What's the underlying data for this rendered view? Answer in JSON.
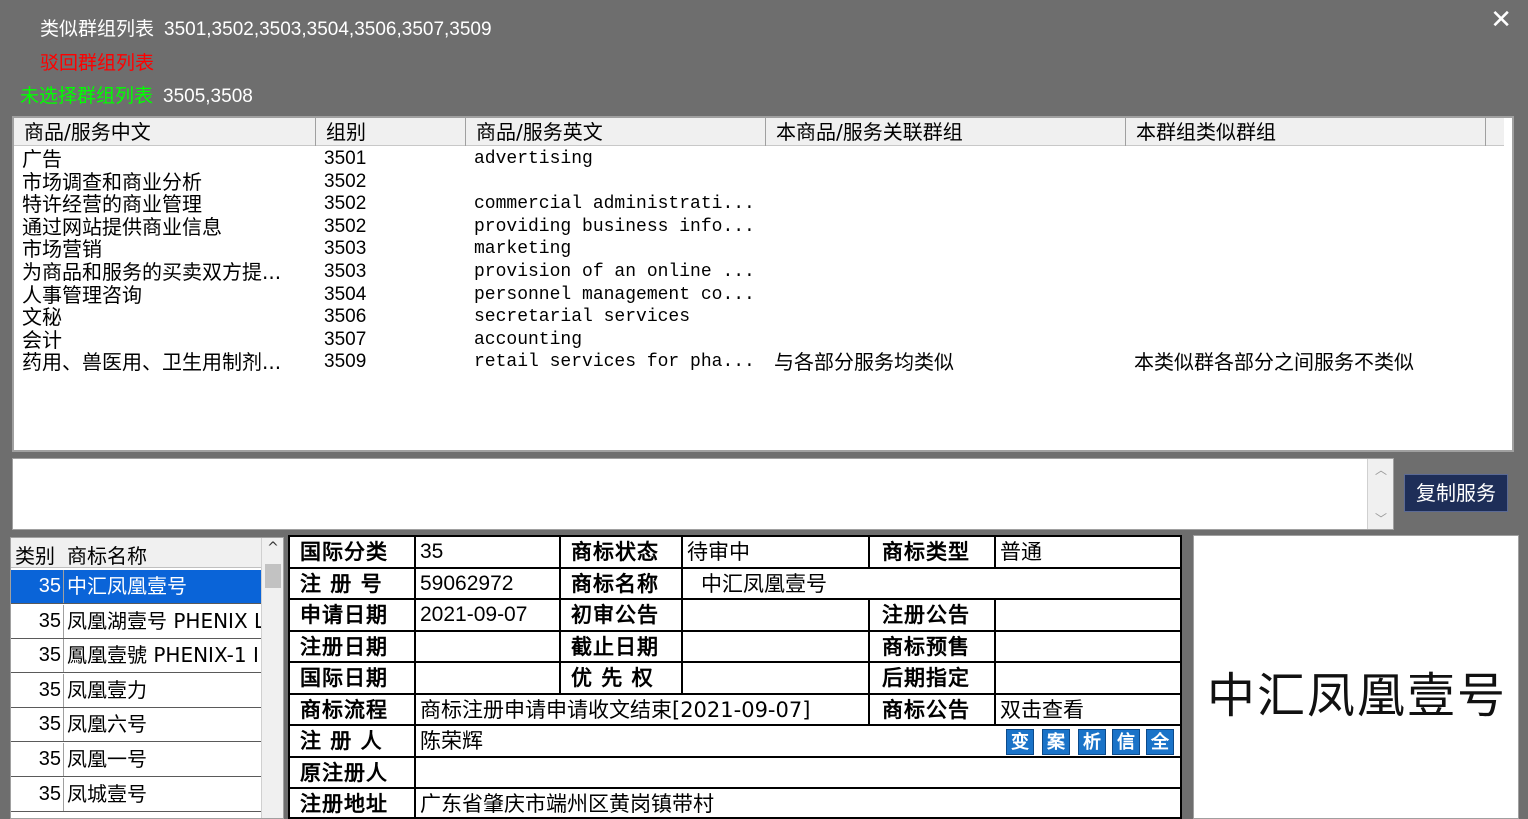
{
  "header": {
    "similar_label": "类似群组列表",
    "similar_groups": "3501,3502,3503,3504,3506,3507,3509",
    "rejected_label": "驳回群组列表",
    "unselected_label": "未选择群组列表",
    "unselected_groups": "3505,3508",
    "close_icon": "✕"
  },
  "colors": {
    "similar": "#ffffff",
    "rejected": "#ff0000",
    "unselected": "#00ff00",
    "selected_row": "#0a64d8",
    "copy_button": "#1e2e58"
  },
  "services": {
    "columns": [
      "商品/服务中文",
      "组别",
      "商品/服务英文",
      "本商品/服务关联群组",
      "本群组类似群组"
    ],
    "rows": [
      {
        "cn": "广告",
        "group": "3501",
        "en": "advertising",
        "rel": "",
        "sim": ""
      },
      {
        "cn": "市场调查和商业分析",
        "group": "3502",
        "en": "",
        "rel": "",
        "sim": ""
      },
      {
        "cn": "特许经营的商业管理",
        "group": "3502",
        "en": "commercial administrati...",
        "rel": "",
        "sim": ""
      },
      {
        "cn": "通过网站提供商业信息",
        "group": "3502",
        "en": "providing business info...",
        "rel": "",
        "sim": ""
      },
      {
        "cn": "市场营销",
        "group": "3503",
        "en": "marketing",
        "rel": "",
        "sim": ""
      },
      {
        "cn": "为商品和服务的买卖双方提...",
        "group": "3503",
        "en": "provision of an online ...",
        "rel": "",
        "sim": ""
      },
      {
        "cn": "人事管理咨询",
        "group": "3504",
        "en": "personnel management co...",
        "rel": "",
        "sim": ""
      },
      {
        "cn": "文秘",
        "group": "3506",
        "en": "secretarial services",
        "rel": "",
        "sim": ""
      },
      {
        "cn": "会计",
        "group": "3507",
        "en": "accounting",
        "rel": "",
        "sim": ""
      },
      {
        "cn": "药用、兽医用、卫生用制剂...",
        "group": "3509",
        "en": "retail services for pha...",
        "rel": "与各部分服务均类似",
        "sim": "本类似群各部分之间服务不类似"
      }
    ]
  },
  "copy_button": "复制服务",
  "trademark_list": {
    "col_class": "类别",
    "col_name": "商标名称",
    "rows": [
      {
        "cls": "35",
        "name": "中汇凤凰壹号",
        "selected": true
      },
      {
        "cls": "35",
        "name": "凤凰湖壹号 PHENIX L",
        "selected": false
      },
      {
        "cls": "35",
        "name": "鳳凰壹號 PHENIX-1 I",
        "selected": false
      },
      {
        "cls": "35",
        "name": "凤凰壹力",
        "selected": false
      },
      {
        "cls": "35",
        "name": "凤凰六号",
        "selected": false
      },
      {
        "cls": "35",
        "name": "凤凰一号",
        "selected": false
      },
      {
        "cls": "35",
        "name": "凤城壹号",
        "selected": false
      }
    ]
  },
  "detail": {
    "intl_class_label": "国际分类",
    "intl_class": "35",
    "status_label": "商标状态",
    "status": "待审中",
    "type_label": "商标类型",
    "type": "普通",
    "reg_no_label": "注 册 号",
    "reg_no": "59062972",
    "name_label": "商标名称",
    "name": "中汇凤凰壹号",
    "apply_date_label": "申请日期",
    "apply_date": "2021-09-07",
    "prelim_label": "初审公告",
    "prelim": "",
    "reg_notice_label": "注册公告",
    "reg_notice": "",
    "reg_date_label": "注册日期",
    "reg_date": "",
    "expire_label": "截止日期",
    "expire": "",
    "presale_label": "商标预售",
    "presale": "",
    "intl_date_label": "国际日期",
    "intl_date": "",
    "priority_label": "优 先 权",
    "priority": "",
    "later_label": "后期指定",
    "later": "",
    "flow_label": "商标流程",
    "flow": "商标注册申请申请收文结束[2021-09-07]",
    "notice_label": "商标公告",
    "notice": "双击查看",
    "registrant_label": "注 册 人",
    "registrant": "陈荣辉",
    "tags": [
      "变",
      "案",
      "析",
      "信",
      "全"
    ],
    "orig_reg_label": "原注册人",
    "orig_reg": "",
    "address_label": "注册地址",
    "address": "广东省肇庆市端州区黄岗镇带村"
  },
  "image_text": "中汇凤凰壹号"
}
